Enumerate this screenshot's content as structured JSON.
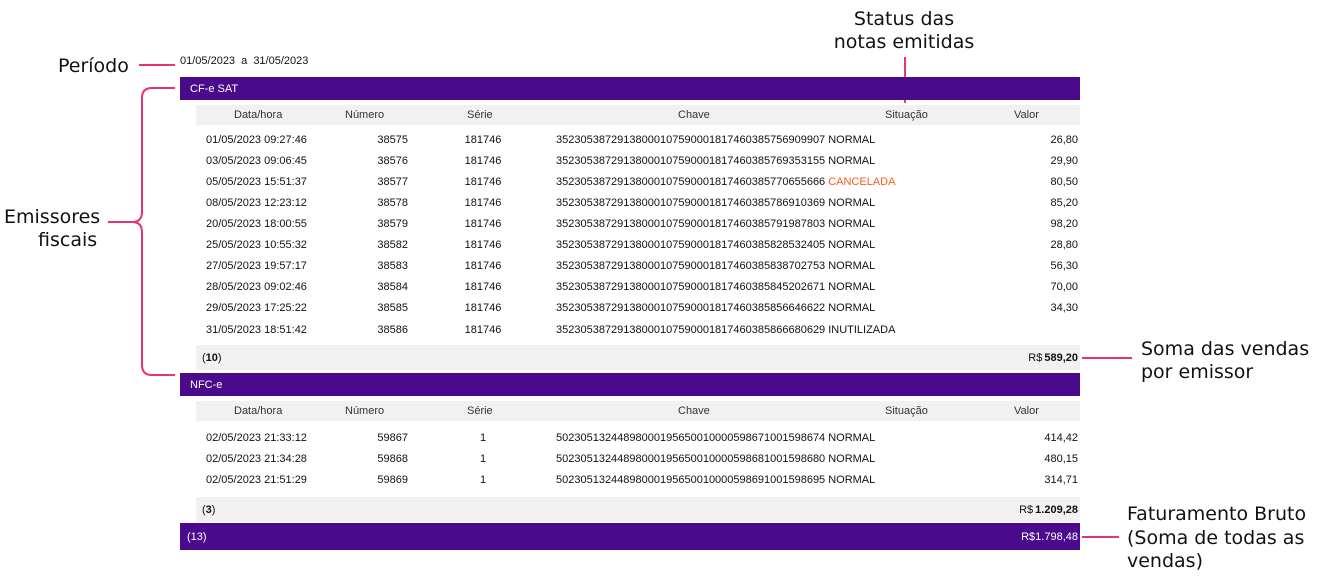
{
  "annotations": {
    "periodo": "Período",
    "status_line1": "Status das",
    "status_line2": "notas emitidas",
    "emissores_line1": "Emissores",
    "emissores_line2": "fiscais",
    "soma_line1": "Soma das vendas",
    "soma_line2": "por emissor",
    "fat_line1": "Faturamento Bruto",
    "fat_line2": "(Soma de todas as",
    "fat_line3": "vendas)"
  },
  "period": {
    "start": "01/05/2023",
    "sep": "a",
    "end": "31/05/2023"
  },
  "columns": {
    "date": "Data/hora",
    "number": "Número",
    "series": "Série",
    "key": "Chave",
    "status": "Situação",
    "value": "Valor"
  },
  "sections": [
    {
      "title": "CF-e SAT",
      "rows": [
        {
          "date": "01/05/2023 09:27:46",
          "number": "38575",
          "series": "181746",
          "key": "35230538729138000107590001817460385756909907",
          "status": "NORMAL",
          "value": "26,80"
        },
        {
          "date": "03/05/2023 09:06:45",
          "number": "38576",
          "series": "181746",
          "key": "35230538729138000107590001817460385769353155",
          "status": "NORMAL",
          "value": "29,90"
        },
        {
          "date": "05/05/2023 15:51:37",
          "number": "38577",
          "series": "181746",
          "key": "35230538729138000107590001817460385770655666",
          "status": "CANCELADA",
          "value": "80,50"
        },
        {
          "date": "08/05/2023 12:23:12",
          "number": "38578",
          "series": "181746",
          "key": "35230538729138000107590001817460385786910369",
          "status": "NORMAL",
          "value": "85,20"
        },
        {
          "date": "20/05/2023 18:00:55",
          "number": "38579",
          "series": "181746",
          "key": "35230538729138000107590001817460385791987803",
          "status": "NORMAL",
          "value": "98,20"
        },
        {
          "date": "25/05/2023 10:55:32",
          "number": "38582",
          "series": "181746",
          "key": "35230538729138000107590001817460385828532405",
          "status": "NORMAL",
          "value": "28,80"
        },
        {
          "date": "27/05/2023 19:57:17",
          "number": "38583",
          "series": "181746",
          "key": "35230538729138000107590001817460385838702753",
          "status": "NORMAL",
          "value": "56,30"
        },
        {
          "date": "28/05/2023 09:02:46",
          "number": "38584",
          "series": "181746",
          "key": "35230538729138000107590001817460385845202671",
          "status": "NORMAL",
          "value": "70,00"
        },
        {
          "date": "29/05/2023 17:25:22",
          "number": "38585",
          "series": "181746",
          "key": "35230538729138000107590001817460385856646622",
          "status": "NORMAL",
          "value": "34,30"
        },
        {
          "date": "31/05/2023 18:51:42",
          "number": "38586",
          "series": "181746",
          "key": "35230538729138000107590001817460385866680629",
          "status": "INUTILIZADA",
          "value": ""
        }
      ],
      "count": "10",
      "total_prefix": "R$",
      "total": "589,20"
    },
    {
      "title": "NFC-e",
      "rows": [
        {
          "date": "02/05/2023 21:33:12",
          "number": "59867",
          "series": "1",
          "key": "50230513244898000195650010000598671001598674",
          "status": "NORMAL",
          "value": "414,42"
        },
        {
          "date": "02/05/2023 21:34:28",
          "number": "59868",
          "series": "1",
          "key": "50230513244898000195650010000598681001598680",
          "status": "NORMAL",
          "value": "480,15"
        },
        {
          "date": "02/05/2023 21:51:29",
          "number": "59869",
          "series": "1",
          "key": "50230513244898000195650010000598691001598695",
          "status": "NORMAL",
          "value": "314,71"
        }
      ],
      "count": "3",
      "total_prefix": "R$",
      "total": "1.209,28"
    }
  ],
  "grand_total": {
    "count": "(13)",
    "total": "R$1.798,48"
  },
  "colors": {
    "purple": "#4a0a8c",
    "pink": "#e8336d",
    "cancel": "#ff5a1f",
    "row_bg": "#f1f1f1"
  }
}
